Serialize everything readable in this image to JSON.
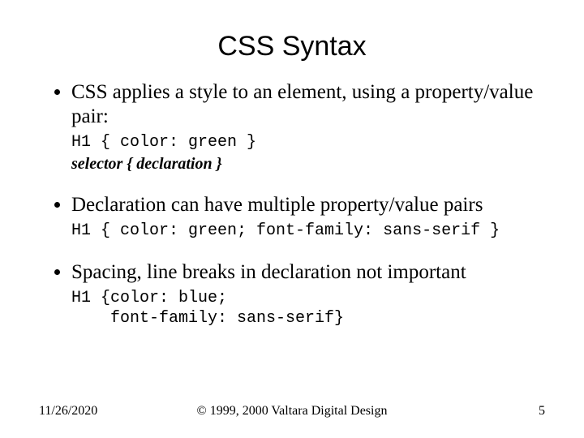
{
  "title": "CSS Syntax",
  "bullets": {
    "b1": "CSS applies a style to an element, using a property/value pair:",
    "b1_code": "H1 { color: green }",
    "b1_anno": "selector { declaration }",
    "b2": "Declaration can have multiple property/value pairs",
    "b2_code": "H1 { color: green; font-family: sans-serif }",
    "b3": "Spacing, line breaks in declaration not important",
    "b3_code": "H1 {color: blue;\n    font-family: sans-serif}"
  },
  "footer": {
    "date": "11/26/2020",
    "copyright": "© 1999, 2000 Valtara Digital Design",
    "page": "5"
  }
}
